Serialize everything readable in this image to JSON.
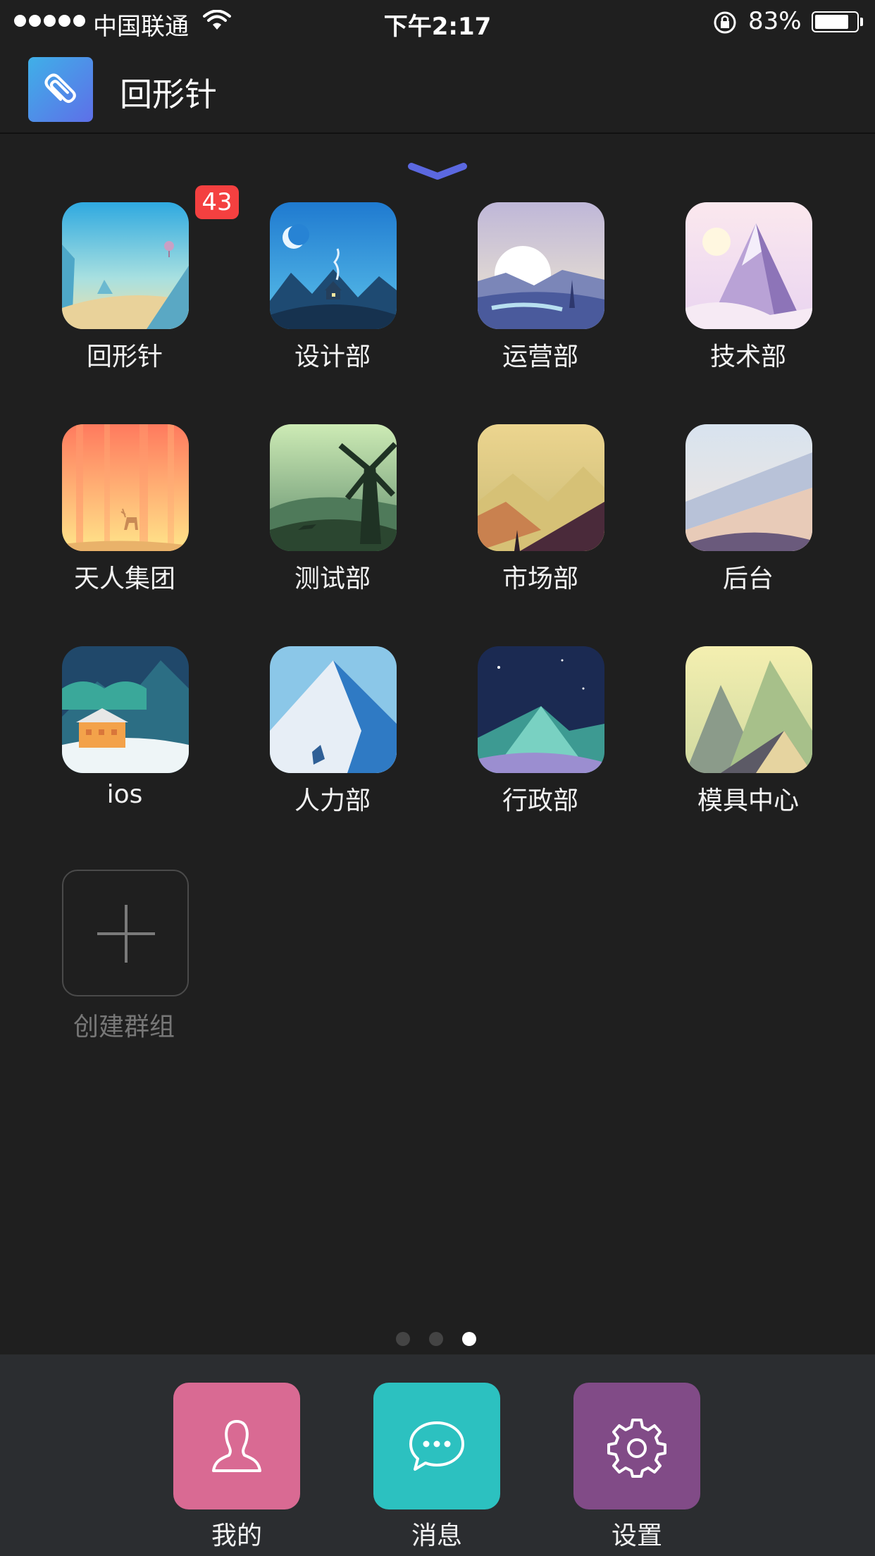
{
  "status_bar": {
    "carrier": "中国联通",
    "time": "下午2:17",
    "battery_percent_label": "83%",
    "battery_level": 0.83
  },
  "header": {
    "app_title": "回形针",
    "logo_icon": "paperclip-icon"
  },
  "groups": [
    {
      "label": "回形针",
      "badge": "43",
      "art": "desert-balloon"
    },
    {
      "label": "设计部",
      "art": "night-cabin"
    },
    {
      "label": "运营部",
      "art": "sunrise-lake"
    },
    {
      "label": "技术部",
      "art": "crystal-mountain"
    },
    {
      "label": "天人集团",
      "art": "sunset-forest-deer"
    },
    {
      "label": "测试部",
      "art": "windmill-hills"
    },
    {
      "label": "市场部",
      "art": "golden-valley"
    },
    {
      "label": "后台",
      "art": "snowy-slopes"
    },
    {
      "label": "ios",
      "art": "winter-house"
    },
    {
      "label": "人力部",
      "art": "blue-glacier"
    },
    {
      "label": "行政部",
      "art": "starry-teal-mountain"
    },
    {
      "label": "模具中心",
      "art": "pastel-peaks"
    }
  ],
  "create_group": {
    "label": "创建群组",
    "icon": "plus-icon"
  },
  "pager": {
    "total": 3,
    "current": 3
  },
  "tabs": [
    {
      "label": "我的",
      "icon": "user-icon",
      "color": "#d96a93"
    },
    {
      "label": "消息",
      "icon": "chat-bubble-icon",
      "color": "#2cc1c0"
    },
    {
      "label": "设置",
      "icon": "gear-icon",
      "color": "#814b87"
    }
  ],
  "colors": {
    "badge": "#f44040",
    "accent_chevron": "#5b68e0",
    "background": "#1f1f1f"
  }
}
